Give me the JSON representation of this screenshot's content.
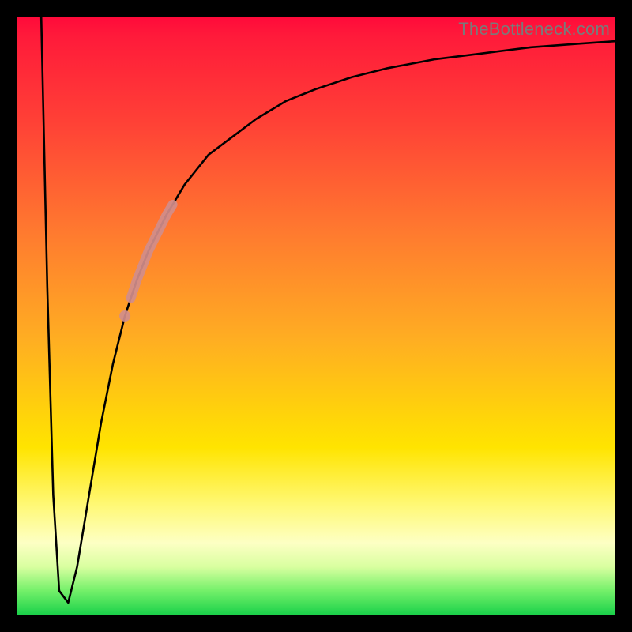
{
  "attribution": "TheBottleneck.com",
  "colors": {
    "frame": "#000000",
    "gradient_top": "#ff0a3a",
    "gradient_bottom": "#1bd14a",
    "curve": "#000000",
    "highlight": "#d18d8b"
  },
  "chart_data": {
    "type": "line",
    "title": "",
    "xlabel": "",
    "ylabel": "",
    "xlim": [
      0,
      100
    ],
    "ylim": [
      0,
      100
    ],
    "grid": false,
    "legend": false,
    "background_gradient_stops": [
      {
        "pos": 0,
        "color": "#ff0a3a"
      },
      {
        "pos": 18,
        "color": "#ff4236"
      },
      {
        "pos": 36,
        "color": "#ff7a2f"
      },
      {
        "pos": 54,
        "color": "#ffae22"
      },
      {
        "pos": 72,
        "color": "#ffe400"
      },
      {
        "pos": 88,
        "color": "#fdffc4"
      },
      {
        "pos": 96,
        "color": "#74f06a"
      },
      {
        "pos": 100,
        "color": "#1bd14a"
      }
    ],
    "series": [
      {
        "name": "bottleneck-curve",
        "x": [
          4,
          5,
          6,
          7,
          8.5,
          10,
          12,
          14,
          16,
          18,
          20,
          22,
          25,
          28,
          32,
          36,
          40,
          45,
          50,
          56,
          62,
          70,
          78,
          86,
          94,
          100
        ],
        "y": [
          100,
          55,
          20,
          4,
          2,
          8,
          20,
          32,
          42,
          50,
          56,
          61,
          67,
          72,
          77,
          80,
          83,
          86,
          88,
          90,
          91.5,
          93,
          94,
          95,
          95.6,
          96
        ]
      }
    ],
    "highlight_segment": {
      "series": "bottleneck-curve",
      "x_range": [
        19,
        26
      ],
      "note": "thick salmon segment on rising part of curve"
    },
    "highlight_point": {
      "series": "bottleneck-curve",
      "x": 18,
      "note": "isolated salmon dot just below the segment"
    }
  }
}
